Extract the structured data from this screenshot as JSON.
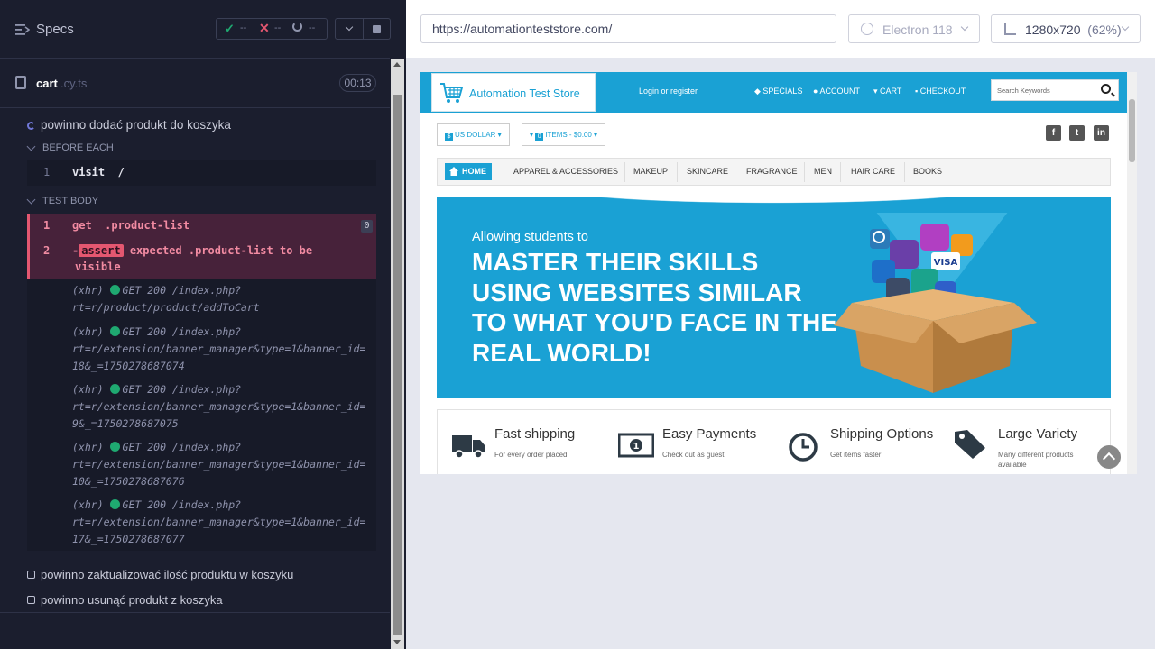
{
  "reporter": {
    "specs_label": "Specs",
    "stats": {
      "passed": "--",
      "failed": "--",
      "pending": "--"
    },
    "file": {
      "name": "cart",
      "ext": ".cy.ts",
      "duration": "00:13"
    },
    "tests": [
      {
        "title": "powinno dodać produkt do koszyka",
        "before_each_label": "BEFORE EACH",
        "before_each": [
          {
            "num": "1",
            "name": "visit",
            "arg": "/"
          }
        ],
        "test_body_label": "TEST BODY",
        "failed_commands": [
          {
            "num": "1",
            "text": "get  .product-list",
            "badge": "0"
          },
          {
            "num": "2",
            "prefix": "-",
            "pill": "assert",
            "line1": " expected .product-list to be",
            "line2": "visible"
          }
        ],
        "xhr": [
          {
            "line1": "(xhr)  GET 200 /index.php?",
            "line2": "rt=r/product/product/addToCart"
          },
          {
            "line1": "(xhr)  GET 200 /index.php?",
            "line2": "rt=r/extension/banner_manager&type=1&banner_id=",
            "line3": "18&_=1750278687074"
          },
          {
            "line1": "(xhr)  GET 200 /index.php?",
            "line2": "rt=r/extension/banner_manager&type=1&banner_id=",
            "line3": "9&_=1750278687075"
          },
          {
            "line1": "(xhr)  GET 200 /index.php?",
            "line2": "rt=r/extension/banner_manager&type=1&banner_id=",
            "line3": "10&_=1750278687076"
          },
          {
            "line1": "(xhr)  GET 200 /index.php?",
            "line2": "rt=r/extension/banner_manager&type=1&banner_id=",
            "line3": "17&_=1750278687077"
          }
        ]
      },
      {
        "title": "powinno zaktualizować ilość produktu w koszyku"
      },
      {
        "title": "powinno usunąć produkt z koszyka"
      }
    ]
  },
  "preview": {
    "url": "https://automationteststore.com/",
    "browser": "Electron 118",
    "viewport": "1280x720",
    "zoom": "(62%)"
  },
  "site": {
    "logo": "Automation Test Store",
    "login": "Login or register",
    "top_nav": [
      "SPECIALS",
      "ACCOUNT",
      "CART",
      "CHECKOUT"
    ],
    "search_placeholder": "Search Keywords",
    "currency": "US DOLLAR",
    "cart_items": "ITEMS - $0.00",
    "social": [
      "f",
      "t",
      "in"
    ],
    "nav": [
      "HOME",
      "APPAREL & ACCESSORIES",
      "MAKEUP",
      "SKINCARE",
      "FRAGRANCE",
      "MEN",
      "HAIR CARE",
      "BOOKS"
    ],
    "hero_sub": "Allowing students to",
    "hero_head": "MASTER THEIR SKILLS USING WEBSITES SIMILAR TO WHAT YOU'D FACE IN THE REAL WORLD!",
    "features": [
      {
        "title": "Fast shipping",
        "sub": "For every order placed!"
      },
      {
        "title": "Easy Payments",
        "sub": "Check out as guest!"
      },
      {
        "title": "Shipping Options",
        "sub": "Get items faster!"
      },
      {
        "title": "Large Variety",
        "sub": "Many different products available"
      }
    ],
    "colors": {
      "accent": "#1aa1d4",
      "fail": "#e45770",
      "pass": "#1fa971"
    }
  }
}
